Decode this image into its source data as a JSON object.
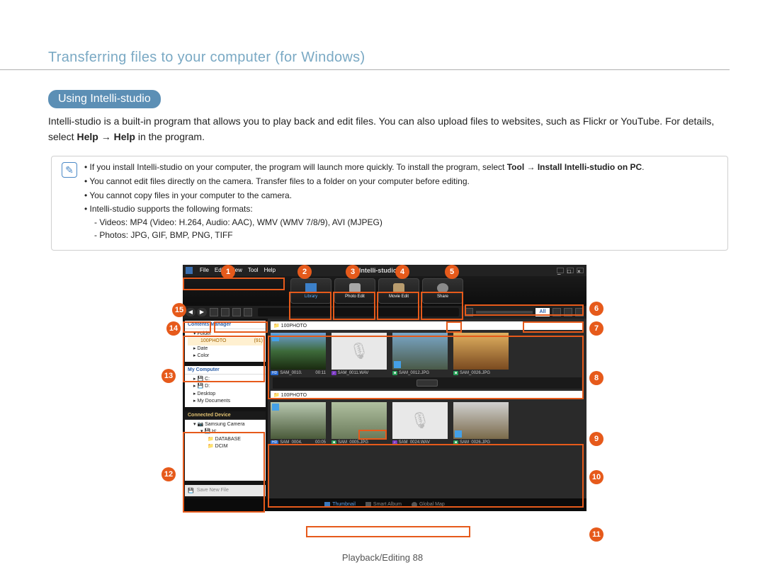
{
  "page": {
    "title": "Transferring files to your computer (for Windows)",
    "section_chip": "Using Intelli-studio",
    "intro_prefix": "Intelli-studio is a built-in program that allows you to play back and edit files. You can also upload files to websites, such as Flickr or YouTube. For details, select ",
    "intro_bold1": "Help",
    "intro_arrow": " → ",
    "intro_bold2": "Help",
    "intro_suffix": " in the program.",
    "footer": "Playback/Editing  88"
  },
  "notes": {
    "n1a": "If you install Intelli-studio on your computer, the program will launch more quickly. To install the program, select ",
    "n1b": "Tool",
    "n1c": " → ",
    "n1d": "Install Intelli-studio on PC",
    "n1e": ".",
    "n2": "You cannot edit files directly on the camera. Transfer files to a folder on your computer before editing.",
    "n3": "You cannot copy files in your computer to the camera.",
    "n4": "Intelli-studio supports the following formats:",
    "n4a": "Videos: MP4 (Video: H.264, Audio: AAC), WMV (WMV 7/8/9), AVI (MJPEG)",
    "n4b": "Photos: JPG, GIF, BMP, PNG, TIFF"
  },
  "app": {
    "menu": {
      "file": "File",
      "edit": "Edit",
      "view": "View",
      "tool": "Tool",
      "help": "Help"
    },
    "brand": "Intelli-studio",
    "tabs": {
      "library": "Library",
      "photo": "Photo Edit",
      "movie": "Movie Edit",
      "share": "Share"
    },
    "all": "All",
    "panels": {
      "contents": "Contents Manager",
      "folder": "Folder",
      "folder1": "100PHOTO",
      "folder1n": "(91)",
      "date": "Date",
      "color": "Color",
      "mypc": "My Computer",
      "c": "C:",
      "d": "D:",
      "desktop": "Desktop",
      "mydocs": "My Documents",
      "connected": "Connected Device",
      "samsung": "Samsung Camera",
      "h": "H:",
      "database": "DATABASE",
      "dcim": "DCIM",
      "save": "Save New File"
    },
    "folderbar1": "100PHOTO",
    "folderbar2": "100PHOTO",
    "thumbs1": [
      {
        "tag": "HD",
        "tagcls": "hd",
        "name": "SAM_0010.",
        "extra": "00:11"
      },
      {
        "tag": "♪",
        "tagcls": "snd",
        "name": "SAM_0011.WAV",
        "extra": ""
      },
      {
        "tag": "■",
        "tagcls": "ph",
        "name": "SAM_0012.JPG",
        "extra": ""
      },
      {
        "tag": "■",
        "tagcls": "ph",
        "name": "SAM_0026.JPG",
        "extra": ""
      }
    ],
    "thumbs2": [
      {
        "tag": "HD",
        "tagcls": "hd",
        "name": "SAM_0004.",
        "extra": "00:05"
      },
      {
        "tag": "■",
        "tagcls": "ph",
        "name": "SAM_0005.JPG",
        "extra": ""
      },
      {
        "tag": "♪",
        "tagcls": "snd",
        "name": "SAM_0024.WAV",
        "extra": ""
      },
      {
        "tag": "■",
        "tagcls": "ph",
        "name": "SAM_0026.JPG",
        "extra": ""
      }
    ],
    "footer": {
      "thumb": "Thumbnail",
      "smart": "Smart Album",
      "map": "Global Map"
    }
  },
  "callouts": [
    "1",
    "2",
    "3",
    "4",
    "5",
    "6",
    "7",
    "8",
    "9",
    "10",
    "11",
    "12",
    "13",
    "14",
    "15"
  ]
}
